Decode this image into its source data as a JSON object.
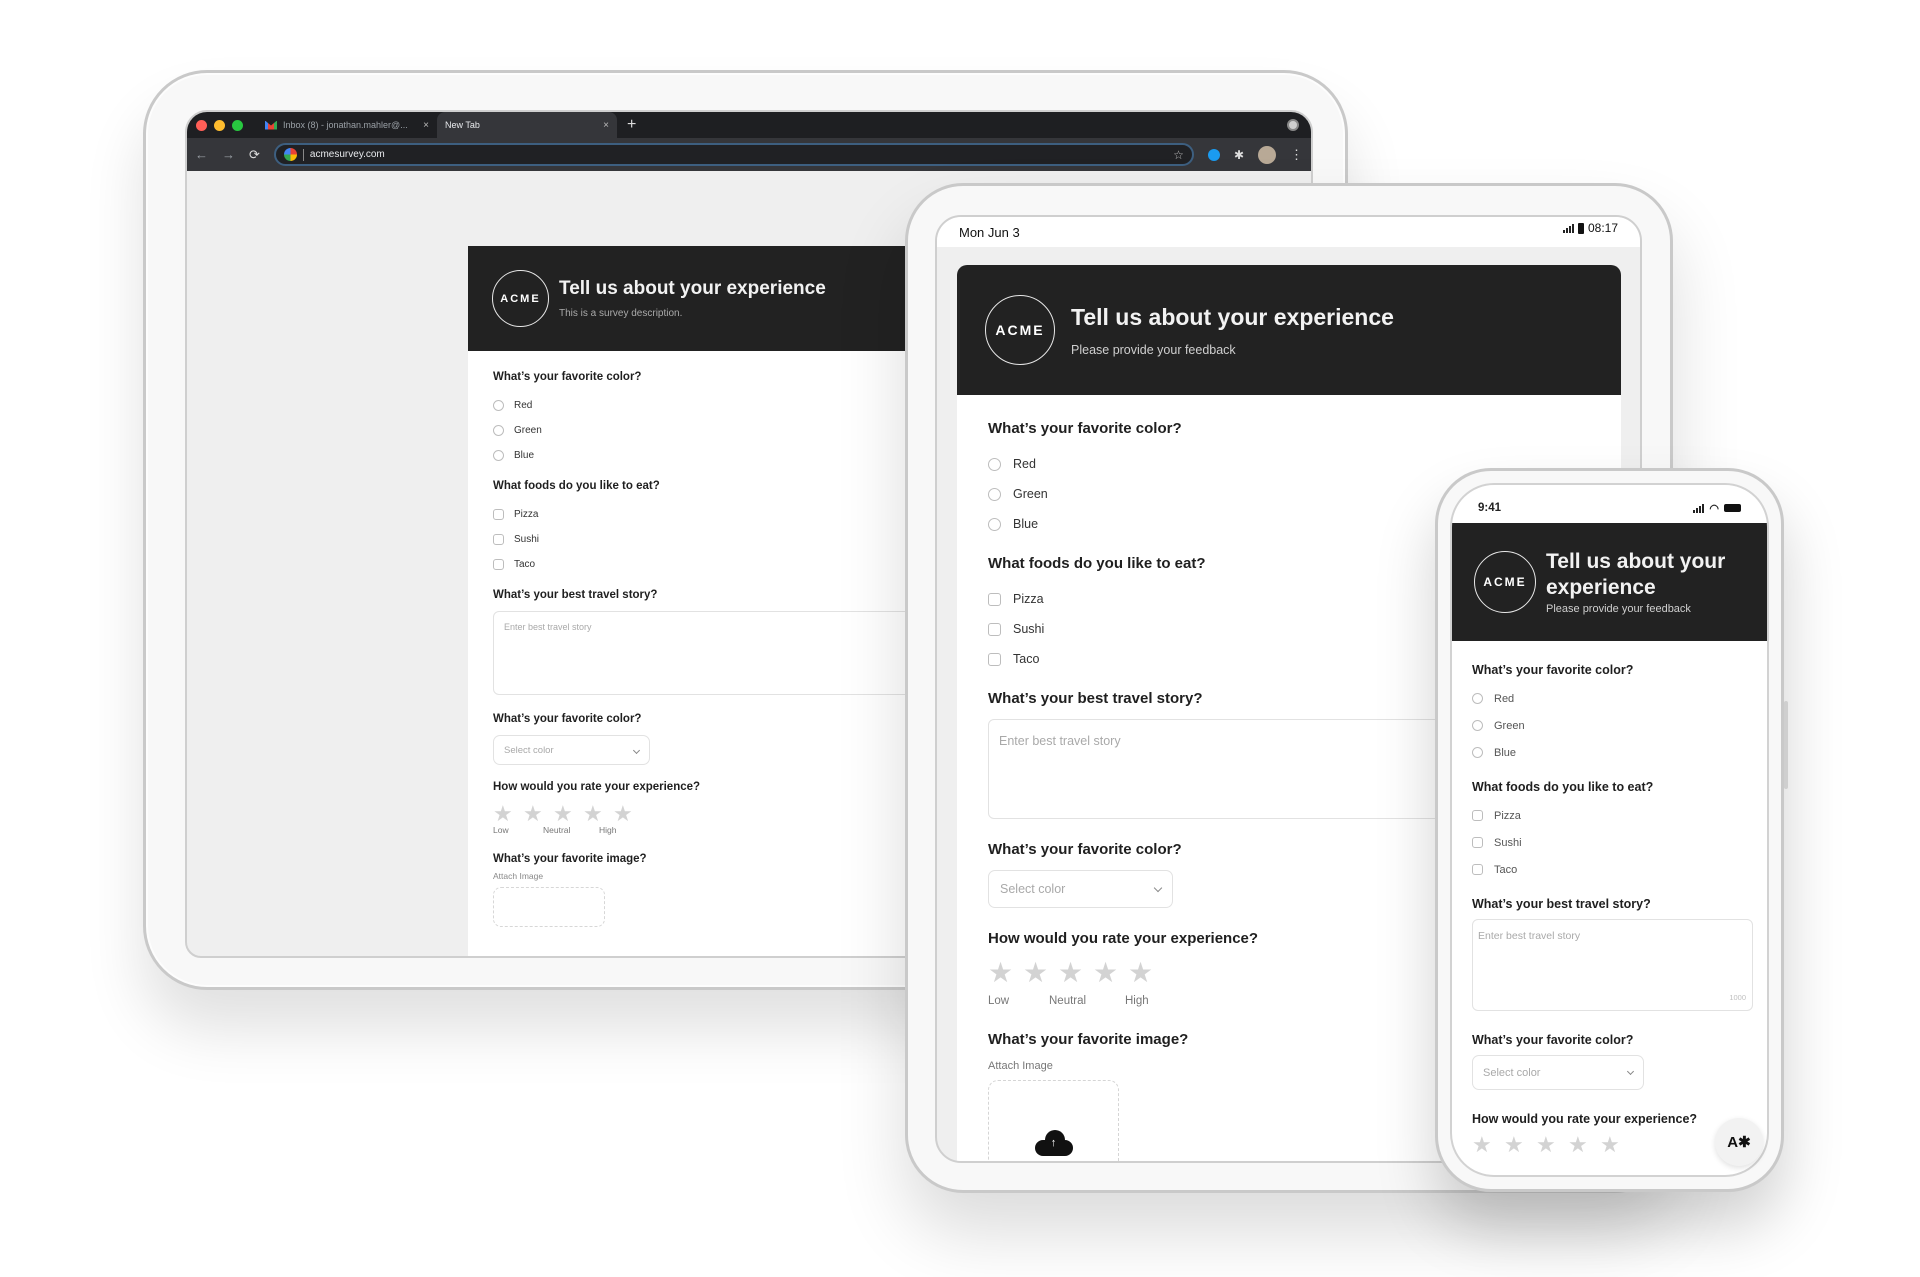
{
  "browser": {
    "tabs": [
      {
        "title": "Inbox (8) - jonathan.mahler@...",
        "icon": "gmail-icon",
        "active": false
      },
      {
        "title": "New Tab",
        "active": true
      }
    ],
    "new_tab_label": "+",
    "close_label": "×",
    "url": "acmesurvey.com",
    "nav": {
      "back": "←",
      "forward": "→",
      "reload": "⟳"
    },
    "bookmark_icon": "☆",
    "menu_icon": "⋮",
    "traffic_colors": [
      "#ff5f57",
      "#febc2e",
      "#28c840"
    ]
  },
  "tablet_status": {
    "date": "Mon Jun 3",
    "time": "08:17"
  },
  "phone_status": {
    "time": "9:41"
  },
  "survey_common": {
    "logo": "ACME",
    "title": "Tell us about your experience",
    "questions": {
      "color_radio": {
        "title": "What’s your favorite color?",
        "options": [
          "Red",
          "Green",
          "Blue"
        ]
      },
      "foods": {
        "title": "What foods do you like to eat?",
        "options": [
          "Pizza",
          "Sushi",
          "Taco"
        ]
      },
      "travel": {
        "title": "What’s your best travel story?",
        "placeholder": "Enter best travel story",
        "max_chars": "1000"
      },
      "color_select": {
        "title": "What’s your favorite color?",
        "placeholder": "Select color"
      },
      "rating": {
        "title": "How would you rate your experience?",
        "stars": 5,
        "value": 0,
        "scale": [
          "Low",
          "Neutral",
          "High"
        ]
      },
      "image": {
        "title": "What’s your favorite image?",
        "attach_label": "Attach Image",
        "upload_label": "Upload File"
      }
    }
  },
  "laptop_survey": {
    "subtitle": "This is a survey description."
  },
  "tablet_survey": {
    "subtitle": "Please provide your feedback"
  },
  "phone_survey": {
    "subtitle": "Please provide your feedback",
    "phone_rating_title": "How would you rate your experience?"
  },
  "accessibility_button": {
    "label": "A✱"
  },
  "colors": {
    "header_bg": "#222222",
    "frame": "#f8f8f8",
    "star_empty": "#d3d3d3"
  }
}
